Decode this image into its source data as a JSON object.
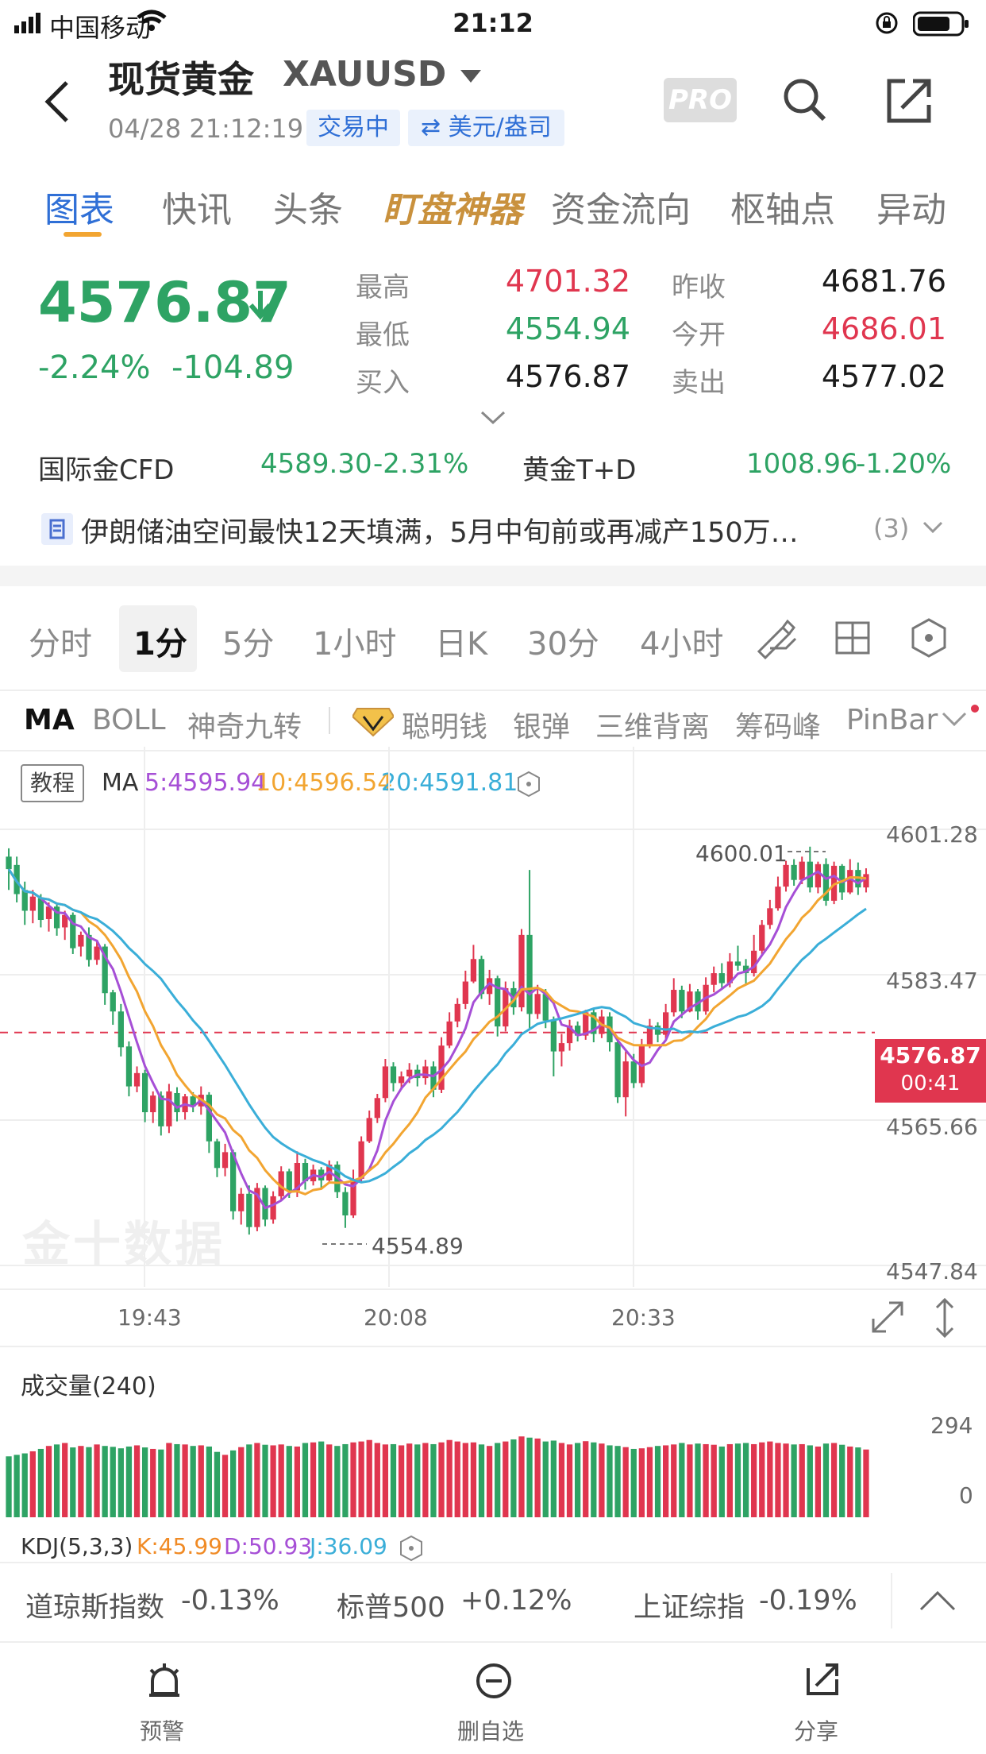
{
  "status_bar": {
    "carrier": "中国移动",
    "time": "21:12"
  },
  "header": {
    "title": "现货黄金",
    "symbol": "XAUUSD",
    "datetime": "04/28 21:12:19",
    "trade_status": "交易中",
    "unit": "⇄ 美元/盎司",
    "pro_label": "PRO"
  },
  "tabs": [
    "图表",
    "快讯",
    "头条",
    "盯盘神器",
    "资金流向",
    "枢轴点",
    "异动"
  ],
  "quote": {
    "price": "4576.87",
    "change_pct": "-2.24%",
    "change": "-104.89",
    "high_label": "最高",
    "high": "4701.32",
    "low_label": "最低",
    "low": "4554.94",
    "buy_label": "买入",
    "buy": "4576.87",
    "prev_label": "昨收",
    "prev": "4681.76",
    "open_label": "今开",
    "open": "4686.01",
    "sell_label": "卖出",
    "sell": "4577.02"
  },
  "related": {
    "cfd_label": "国际金CFD",
    "cfd_price": "4589.30",
    "cfd_pct": "-2.31%",
    "td_label": "黄金T+D",
    "td_price": "1008.96",
    "td_pct": "-1.20%"
  },
  "news": {
    "headline": "伊朗储油空间最快12天填满，5月中旬前或再减产150万…",
    "count": "(3)"
  },
  "periods": [
    "分时",
    "1分",
    "5分",
    "1小时",
    "日K",
    "30分",
    "4小时"
  ],
  "indicators": [
    "MA",
    "BOLL",
    "神奇九转",
    "聪明钱",
    "银弹",
    "三维背离",
    "筹码峰",
    "PinBar"
  ],
  "ma_bar": {
    "tutorial": "教程",
    "label": "MA",
    "ma5": "5:4595.94",
    "ma10": "10:4596.54",
    "ma20": "20:4591.81"
  },
  "chart_labels": {
    "y_ticks": [
      "4601.28",
      "4583.47",
      "4565.66",
      "4547.84"
    ],
    "x_ticks": [
      "19:43",
      "20:08",
      "20:33"
    ],
    "high_mark": "4600.01",
    "low_mark": "4554.89",
    "current_price": "4576.87",
    "countdown": "00:41",
    "watermark": "金十数据"
  },
  "volume": {
    "title": "成交量(240)",
    "max_tick": "294",
    "min_tick": "0"
  },
  "kdj": {
    "label": "KDJ(5,3,3)",
    "k": "K:45.99",
    "d": "D:50.93",
    "j": "J:36.09"
  },
  "footer_indices": [
    {
      "name": "道琼斯指数",
      "pct": "-0.13%"
    },
    {
      "name": "标普500",
      "pct": "+0.12%"
    },
    {
      "name": "上证综指",
      "pct": "-0.19%"
    }
  ],
  "bottom_nav": [
    "预警",
    "删自选",
    "分享"
  ],
  "colors": {
    "up": "#e0364f",
    "down": "#2ea364",
    "accent": "#2f6fd6",
    "gold": "#c9913d",
    "ma5": "#a64fd6",
    "ma10": "#f2a531",
    "ma20": "#3aaed8"
  },
  "chart_data": {
    "type": "candlestick",
    "interval": "1分",
    "ylim": [
      4547.84,
      4601.28
    ],
    "x_ticks": [
      "19:43",
      "20:08",
      "20:33"
    ],
    "candles": [
      [
        4598,
        4596.5,
        4599,
        4594
      ],
      [
        4597,
        4593.5,
        4598,
        4592.5
      ],
      [
        4594,
        4591.5,
        4595,
        4589.8
      ],
      [
        4591.5,
        4593.2,
        4594,
        4590
      ],
      [
        4593,
        4590.4,
        4593.5,
        4589.5
      ],
      [
        4590.5,
        4592,
        4592.5,
        4589
      ],
      [
        4592,
        4589.4,
        4592.5,
        4588.5
      ],
      [
        4589.5,
        4591,
        4591.5,
        4588
      ],
      [
        4591,
        4587,
        4591.3,
        4586.3
      ],
      [
        4587.2,
        4588.6,
        4589,
        4586
      ],
      [
        4588.6,
        4585.6,
        4589.5,
        4584.8
      ],
      [
        4585.6,
        4587.2,
        4588,
        4585
      ],
      [
        4587.2,
        4581.6,
        4587.5,
        4580.2
      ],
      [
        4581.7,
        4579.4,
        4582,
        4577.8
      ],
      [
        4579.4,
        4575.1,
        4580.3,
        4574
      ],
      [
        4575.2,
        4570.4,
        4575.8,
        4569.2
      ],
      [
        4570.4,
        4572,
        4572.8,
        4569.7
      ],
      [
        4572,
        4567.3,
        4572.4,
        4566.1
      ],
      [
        4567.3,
        4569.3,
        4569.8,
        4566
      ],
      [
        4569.3,
        4565.6,
        4569.8,
        4564.5
      ],
      [
        4565.6,
        4569.8,
        4570.7,
        4564.8
      ],
      [
        4569.6,
        4567.3,
        4570.3,
        4566.2
      ],
      [
        4567.3,
        4569.2,
        4569.5,
        4566.4
      ],
      [
        4569.2,
        4568,
        4569.7,
        4567.3
      ],
      [
        4568,
        4569.4,
        4570.4,
        4567
      ],
      [
        4569.4,
        4563.8,
        4569.7,
        4562.4
      ],
      [
        4563.8,
        4560.6,
        4564.1,
        4559.5
      ],
      [
        4560.6,
        4562.5,
        4563.5,
        4559.6
      ],
      [
        4562.5,
        4555.4,
        4562.8,
        4554.4
      ],
      [
        4555.4,
        4557.5,
        4558.2,
        4553.8
      ],
      [
        4557.5,
        4553.5,
        4558.5,
        4552.6
      ],
      [
        4553.5,
        4558.2,
        4558.8,
        4553
      ],
      [
        4558.2,
        4554.4,
        4558.5,
        4553.6
      ],
      [
        4554.4,
        4557.2,
        4557.8,
        4553.9
      ],
      [
        4557.2,
        4560.2,
        4560.8,
        4556.6
      ],
      [
        4560.2,
        4557.9,
        4560.5,
        4557
      ],
      [
        4557.9,
        4561.2,
        4562.6,
        4557.1
      ],
      [
        4561.2,
        4559,
        4561.7,
        4558
      ],
      [
        4559,
        4560.4,
        4561,
        4558.5
      ],
      [
        4560.4,
        4559.1,
        4560.7,
        4558.2
      ],
      [
        4559.1,
        4561,
        4561.5,
        4558.8
      ],
      [
        4561,
        4557.7,
        4561.4,
        4557
      ],
      [
        4557.7,
        4554.9,
        4558.3,
        4553.4
      ],
      [
        4554.9,
        4559.3,
        4560.4,
        4554.6
      ],
      [
        4559.3,
        4563.8,
        4564.4,
        4559
      ],
      [
        4563.8,
        4566.6,
        4567.5,
        4563.6
      ],
      [
        4566.6,
        4569,
        4569.5,
        4566
      ],
      [
        4569,
        4572.8,
        4573.7,
        4568.5
      ],
      [
        4572.8,
        4570.8,
        4573.3,
        4569.8
      ],
      [
        4570.8,
        4571.6,
        4572.2,
        4570
      ],
      [
        4571.6,
        4572.4,
        4573.2,
        4570.8
      ],
      [
        4572.4,
        4571.4,
        4573,
        4570.4
      ],
      [
        4571.4,
        4572.8,
        4573.6,
        4570.6
      ],
      [
        4572.8,
        4570,
        4573.4,
        4569.1
      ],
      [
        4570,
        4575.3,
        4576.3,
        4569.6
      ],
      [
        4575.3,
        4578.2,
        4579.3,
        4575
      ],
      [
        4578.2,
        4580.3,
        4581,
        4577.5
      ],
      [
        4580.3,
        4583,
        4584.3,
        4579.7
      ],
      [
        4583,
        4585.7,
        4587.4,
        4582.8
      ],
      [
        4585.7,
        4581.5,
        4586.1,
        4580.9
      ],
      [
        4581.5,
        4583.4,
        4584.4,
        4580.2
      ],
      [
        4583.4,
        4577.6,
        4583.7,
        4576.4
      ],
      [
        4577.6,
        4582.2,
        4583,
        4577
      ],
      [
        4582.2,
        4579.9,
        4583,
        4579
      ],
      [
        4579.9,
        4588.6,
        4589.3,
        4579.4
      ],
      [
        4588.6,
        4579.1,
        4596.4,
        4577.3
      ],
      [
        4579.1,
        4581.5,
        4582.6,
        4578.5
      ],
      [
        4581.5,
        4578.3,
        4582.1,
        4577.4
      ],
      [
        4578.3,
        4574.6,
        4578.8,
        4571.6
      ],
      [
        4574.6,
        4575.6,
        4576.7,
        4572.8
      ],
      [
        4575.6,
        4577.7,
        4578.4,
        4574.7
      ],
      [
        4577.7,
        4576.5,
        4578.2,
        4575.8
      ],
      [
        4576.5,
        4579.3,
        4579.6,
        4576
      ],
      [
        4579.3,
        4576.7,
        4579.7,
        4575.7
      ],
      [
        4576.7,
        4578.8,
        4579.6,
        4576.2
      ],
      [
        4578.8,
        4575.7,
        4579.3,
        4574.6
      ],
      [
        4575.7,
        4569.1,
        4576.3,
        4568.4
      ],
      [
        4569.1,
        4573.4,
        4574.6,
        4566.8
      ],
      [
        4573.4,
        4570.8,
        4574.3,
        4570.2
      ],
      [
        4570.8,
        4575.3,
        4576.1,
        4570.3
      ],
      [
        4575.3,
        4577.7,
        4578.5,
        4575
      ],
      [
        4577.7,
        4576.6,
        4578.1,
        4575.7
      ],
      [
        4576.6,
        4579.3,
        4580.3,
        4576.1
      ],
      [
        4579.3,
        4582,
        4583.4,
        4578.8
      ],
      [
        4582,
        4579.4,
        4582.5,
        4578.6
      ],
      [
        4579.4,
        4581.8,
        4582.7,
        4579.3
      ],
      [
        4581.8,
        4579.4,
        4582.1,
        4578.4
      ],
      [
        4579.4,
        4582.6,
        4583.5,
        4579
      ],
      [
        4582.6,
        4584,
        4584.8,
        4581.7
      ],
      [
        4584,
        4582.8,
        4585.2,
        4582.1
      ],
      [
        4582.8,
        4585.4,
        4586.4,
        4582.3
      ],
      [
        4585.4,
        4584.9,
        4587.3,
        4584.3
      ],
      [
        4584.9,
        4584,
        4585.7,
        4582.6
      ],
      [
        4584,
        4586.7,
        4588.6,
        4583.6
      ],
      [
        4586.7,
        4589.8,
        4590.4,
        4586.3
      ],
      [
        4589.8,
        4591.8,
        4592.8,
        4589.3
      ],
      [
        4591.8,
        4594.4,
        4595.6,
        4591.5
      ],
      [
        4594.4,
        4597,
        4597.5,
        4593.8
      ],
      [
        4597,
        4595.2,
        4597.7,
        4594.5
      ],
      [
        4595.2,
        4597.4,
        4598,
        4594.7
      ],
      [
        4597.4,
        4594.3,
        4599.2,
        4593.7
      ],
      [
        4594.3,
        4597.1,
        4597.4,
        4593.6
      ],
      [
        4597.1,
        4592.7,
        4597.8,
        4592.1
      ],
      [
        4592.7,
        4596.9,
        4597.4,
        4592.3
      ],
      [
        4596.9,
        4593.7,
        4597.1,
        4592.8
      ],
      [
        4593.7,
        4596.4,
        4597.7,
        4593.5
      ],
      [
        4596.4,
        4594.3,
        4597.3,
        4593.4
      ],
      [
        4594.3,
        4595.9,
        4596.6,
        4593.7
      ]
    ],
    "volume_ylim": [
      0,
      294
    ],
    "volume": [
      205,
      210,
      215,
      222,
      230,
      240,
      245,
      250,
      235,
      240,
      236,
      245,
      240,
      237,
      232,
      238,
      242,
      235,
      230,
      228,
      250,
      246,
      245,
      240,
      242,
      238,
      220,
      210,
      225,
      236,
      245,
      250,
      244,
      242,
      245,
      240,
      238,
      250,
      252,
      255,
      245,
      240,
      246,
      252,
      255,
      260,
      250,
      245,
      246,
      242,
      248,
      245,
      250,
      246,
      252,
      260,
      255,
      250,
      252,
      245,
      240,
      250,
      255,
      262,
      272,
      268,
      265,
      255,
      258,
      250,
      245,
      250,
      256,
      252,
      248,
      242,
      240,
      236,
      230,
      232,
      236,
      240,
      242,
      245,
      250,
      245,
      248,
      246,
      244,
      238,
      246,
      248,
      250,
      246,
      252,
      255,
      250,
      248,
      245,
      246,
      242,
      238,
      248,
      250,
      244,
      238,
      235,
      228
    ]
  }
}
